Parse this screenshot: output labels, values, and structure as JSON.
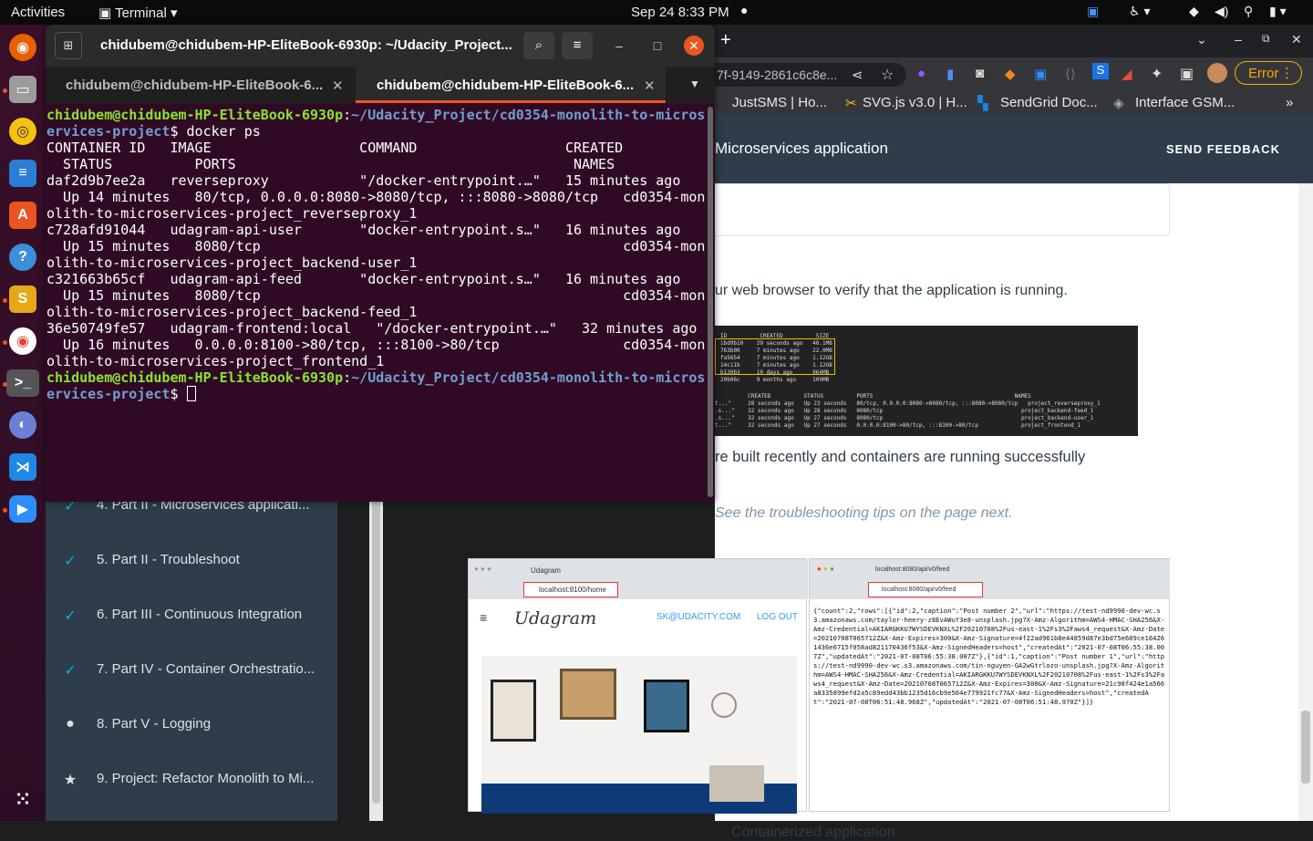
{
  "topbar": {
    "activities": "Activities",
    "app": "Terminal",
    "clock": "Sep 24  8:33 PM"
  },
  "terminal": {
    "title": "chidubem@chidubem-HP-EliteBook-6930p: ~/Udacity_Project...",
    "tabs": [
      {
        "label": "chidubem@chidubem-HP-EliteBook-6..."
      },
      {
        "label": "chidubem@chidubem-HP-EliteBook-6..."
      }
    ],
    "prompt_user": "chidubem@chidubem-HP-EliteBook-6930p",
    "prompt_path_a": "~/Udacity_Project/cd0354-monolith-to-micros",
    "prompt_path_b": "ervices-project",
    "command": "$ docker ps",
    "prompt_end": "$ ",
    "output": [
      "CONTAINER ID   IMAGE                  COMMAND                  CREATED",
      "  STATUS          PORTS                                         NAMES",
      "daf2d9b7ee2a   reverseproxy           \"/docker-entrypoint.…\"   15 minutes ago",
      "  Up 14 minutes   80/tcp, 0.0.0.0:8080->8080/tcp, :::8080->8080/tcp   cd0354-mon",
      "olith-to-microservices-project_reverseproxy_1",
      "c728afd91044   udagram-api-user       \"docker-entrypoint.s…\"   16 minutes ago",
      "  Up 15 minutes   8080/tcp                                            cd0354-mon",
      "olith-to-microservices-project_backend-user_1",
      "c321663b65cf   udagram-api-feed       \"docker-entrypoint.s…\"   16 minutes ago",
      "  Up 15 minutes   8080/tcp                                            cd0354-mon",
      "olith-to-microservices-project_backend-feed_1",
      "36e50749fe57   udagram-frontend:local   \"/docker-entrypoint.…\"   32 minutes ago",
      "  Up 16 minutes   0.0.0.0:8100->80/tcp, :::8100->80/tcp               cd0354-mon",
      "olith-to-microservices-project_frontend_1"
    ]
  },
  "browser": {
    "address_fragment": "7f-9149-2861c6c8e...",
    "error_label": "Error",
    "bookmarks": [
      "JustSMS | Ho...",
      "SVG.js v3.0 | H...",
      "SendGrid Doc...",
      "Interface GSM..."
    ],
    "header_title": "Microservices application",
    "send_feedback": "SEND FEEDBACK",
    "para1": "ur web browser to verify that the application is running.",
    "para2": "re built recently and containers are running successfully",
    "para3": "See the troubleshooting tips on the page next.",
    "caption": "Containerized application",
    "shot_left": {
      "tab": "Udagram",
      "url": "localhost:8100/home",
      "brand": "Udagram",
      "email": "SK@UDACITY.COM",
      "logout": "LOG OUT"
    },
    "shot_right": {
      "tab": "localhost:8080/api/v0/feed",
      "url": "localhost:8080/api/v0/feed",
      "json": "{\"count\":2,\"rows\":[{\"id\":2,\"caption\":\"Post number 2\",\"url\":\"https://test-nd9990-dev-wc.s3.amazonaws.com/taylor-heery-z8EvAWuY3e8-unsplash.jpg?X-Amz-Algorithm=AWS4-HMAC-SHA256&X-Amz-Credential=AKIARGKKU7WYSDEVKNXL%2F20210708%2Fus-east-1%2Fs3%2Faws4_request&X-Amz-Date=20210708T065712Z&X-Amz-Expires=300&X-Amz-Signature=4f22ad961b8e44859d87e3bd75e689ce164261436e6715f058ad821170436f53&X-Amz-SignedHeaders=host\",\"createdAt\":\"2021-07-08T06:55:38.007Z\",\"updatedAt\":\"2021-07-08T06:55:38.007Z\"},{\"id\":1,\"caption\":\"Post number 1\",\"url\":\"https://test-nd9990-dev-wc.s3.amazonaws.com/tin-nguyen-GA2wGtrlozo-unsplash.jpg?X-Amz-Algorithm=AWS4-HMAC-SHA256&X-Amz-Credential=AKIARGKKU7WYSDEVKNXL%2F20210708%2Fus-east-1%2Fs3%2Faws4_request&X-Amz-Date=20210708T065712Z&X-Amz-Expires=300&X-Amz-Signature=21c98f424e1a566a8335899efd2a5c89edd43bb1235d16cb9e564e779921fc77&X-Amz-SignedHeaders=host\",\"createdAt\":\"2021-07-08T06:51:48.968Z\",\"updatedAt\":\"2021-07-08T06:51:48.970Z\"}]}"
    }
  },
  "sidebar": {
    "items": [
      {
        "label": "4. Part II - Microservices applicati...",
        "icon": "check-icon"
      },
      {
        "label": "5. Part II - Troubleshoot",
        "icon": "check-icon"
      },
      {
        "label": "6. Part III - Continuous Integration",
        "icon": "check-icon"
      },
      {
        "label": "7. Part IV - Container Orchestratio...",
        "icon": "check-icon"
      },
      {
        "label": "8. Part V - Logging",
        "icon": "circle-icon"
      },
      {
        "label": "9. Project: Refactor Monolith to Mi...",
        "icon": "star-icon"
      }
    ]
  }
}
